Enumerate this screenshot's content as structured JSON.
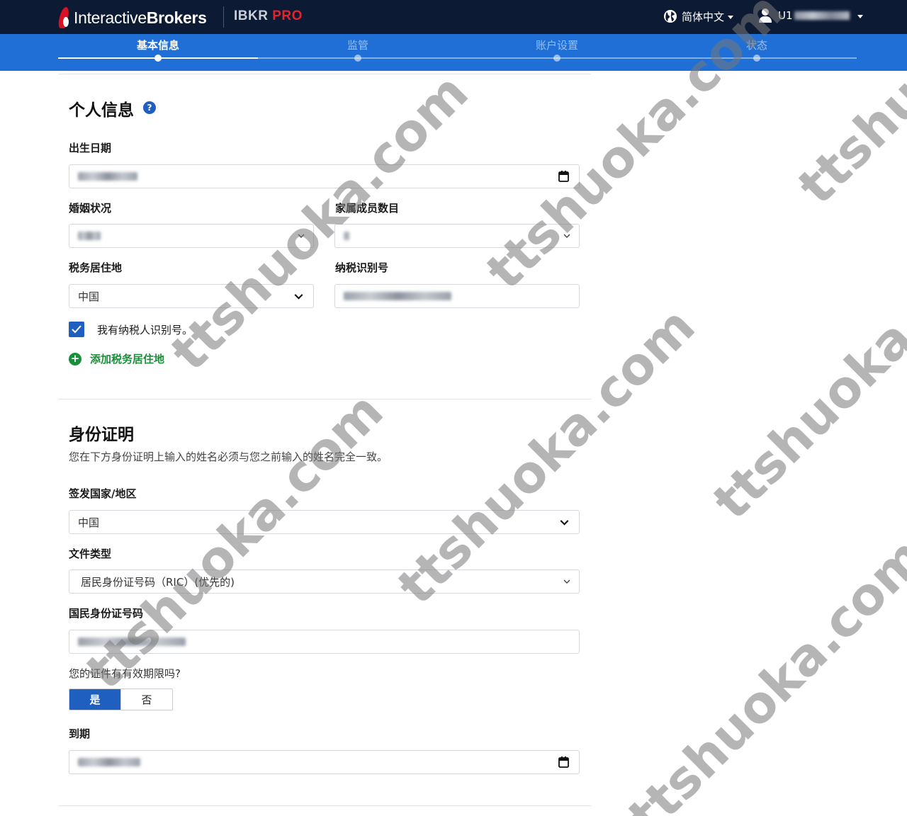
{
  "header": {
    "brand_light": "Interactive",
    "brand_bold": "Brokers",
    "product_prefix": "IBKR",
    "product_suffix": "PRO",
    "language": "简体中文",
    "user_prefix": "U1"
  },
  "steps": [
    {
      "label": "基本信息",
      "active": true
    },
    {
      "label": "监管",
      "active": false
    },
    {
      "label": "账户设置",
      "active": false
    },
    {
      "label": "状态",
      "active": false
    }
  ],
  "personal": {
    "title": "个人信息",
    "help": "?",
    "dob_label": "出生日期",
    "marital_label": "婚姻状况",
    "dependents_label": "家属成员数目",
    "tax_residence_label": "税务居住地",
    "tax_residence_value": "中国",
    "tin_label": "纳税识别号",
    "has_tin_label": "我有纳税人识别号。",
    "add_tax_residence": "添加税务居住地"
  },
  "identity": {
    "title": "身份证明",
    "description": "您在下方身份证明上输入的姓名必须与您之前输入的姓名完全一致。",
    "issuing_country_label": "签发国家/地区",
    "issuing_country_value": "中国",
    "doc_type_label": "文件类型",
    "doc_type_value": "居民身份证号码（RIC）(优先的)",
    "id_number_label": "国民身份证号码",
    "has_expiry_question": "您的证件有有效期限吗?",
    "yes": "是",
    "no": "否",
    "expiry_label": "到期"
  },
  "watermark": "ttshuoka.com",
  "colors": {
    "navbar": "#0d1a33",
    "stepper": "#1f6fd6",
    "primary": "#1f5fbf",
    "success": "#1a8f3a",
    "brand_red": "#d81222"
  }
}
